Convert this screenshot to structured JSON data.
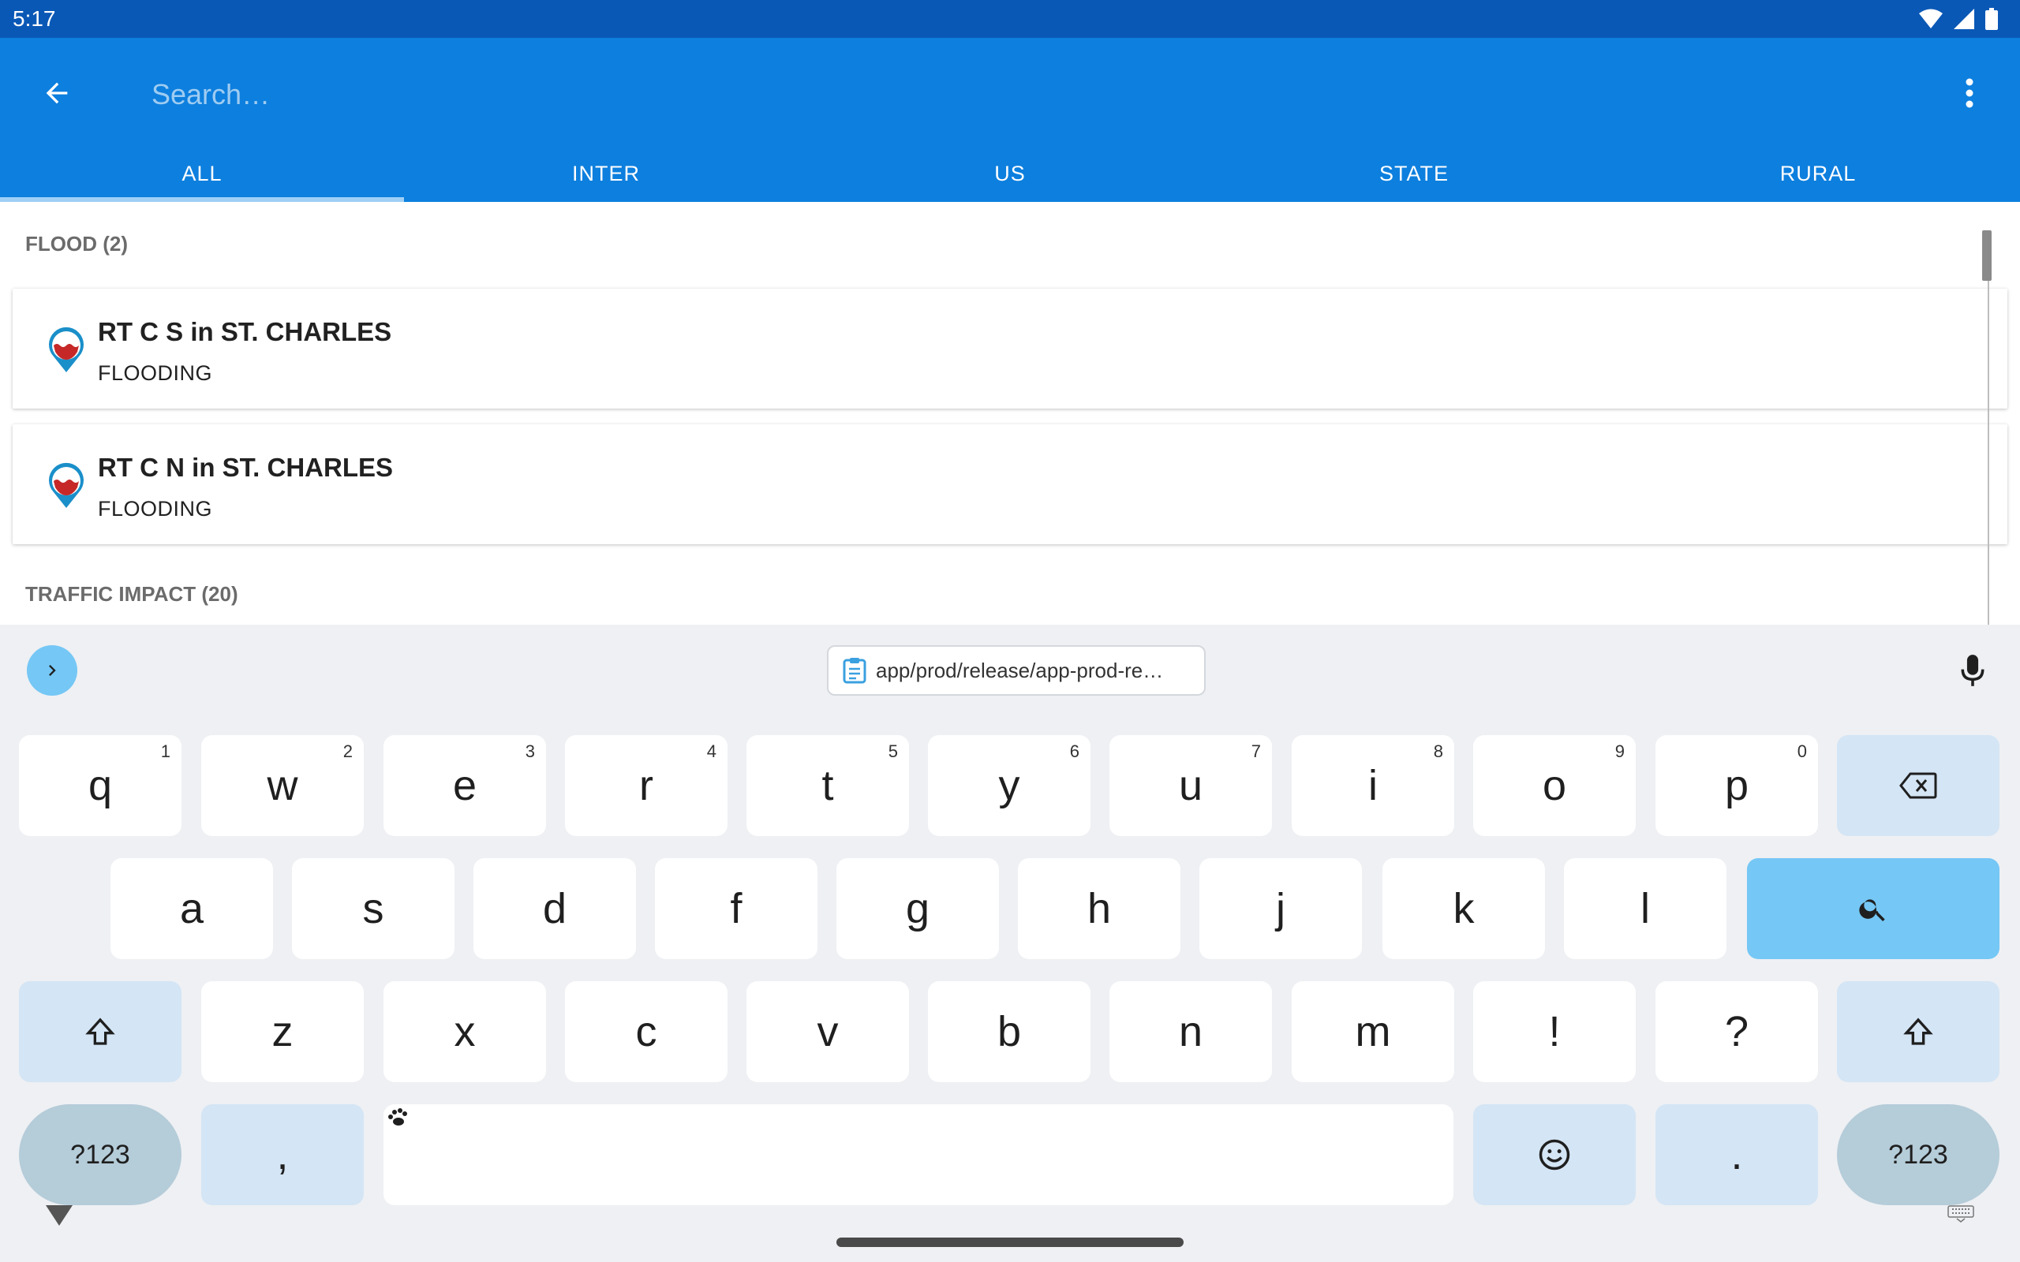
{
  "status_bar": {
    "time": "5:17"
  },
  "app_bar": {
    "search": {
      "placeholder": "Search…",
      "value": ""
    },
    "tabs": [
      {
        "label": "ALL",
        "active": true
      },
      {
        "label": "INTER",
        "active": false
      },
      {
        "label": "US",
        "active": false
      },
      {
        "label": "STATE",
        "active": false
      },
      {
        "label": "RURAL",
        "active": false
      }
    ]
  },
  "sections": [
    {
      "header": "FLOOD (2)",
      "items": [
        {
          "title": "RT C S in ST. CHARLES",
          "subtitle": "FLOODING",
          "icon": "flood-pin-icon"
        },
        {
          "title": "RT C N in ST. CHARLES",
          "subtitle": "FLOODING",
          "icon": "flood-pin-icon"
        }
      ]
    },
    {
      "header": "TRAFFIC IMPACT (20)",
      "items": []
    }
  ],
  "keyboard": {
    "clipboard_text": "app/prod/release/app-prod-re…",
    "row1": [
      {
        "label": "q",
        "hint": "1"
      },
      {
        "label": "w",
        "hint": "2"
      },
      {
        "label": "e",
        "hint": "3"
      },
      {
        "label": "r",
        "hint": "4"
      },
      {
        "label": "t",
        "hint": "5"
      },
      {
        "label": "y",
        "hint": "6"
      },
      {
        "label": "u",
        "hint": "7"
      },
      {
        "label": "i",
        "hint": "8"
      },
      {
        "label": "o",
        "hint": "9"
      },
      {
        "label": "p",
        "hint": "0"
      }
    ],
    "row2": [
      "a",
      "s",
      "d",
      "f",
      "g",
      "h",
      "j",
      "k",
      "l"
    ],
    "row3": [
      "z",
      "x",
      "c",
      "v",
      "b",
      "n",
      "m",
      "!",
      "?"
    ],
    "symbols_label": "?123",
    "comma_label": ",",
    "period_label": "."
  },
  "colors": {
    "status_bar": "#0a58b6",
    "app_bar": "#0d7fde",
    "accent": "#75c7f5",
    "fab": "#8fcbf2",
    "flood_icon": "#c62828"
  }
}
